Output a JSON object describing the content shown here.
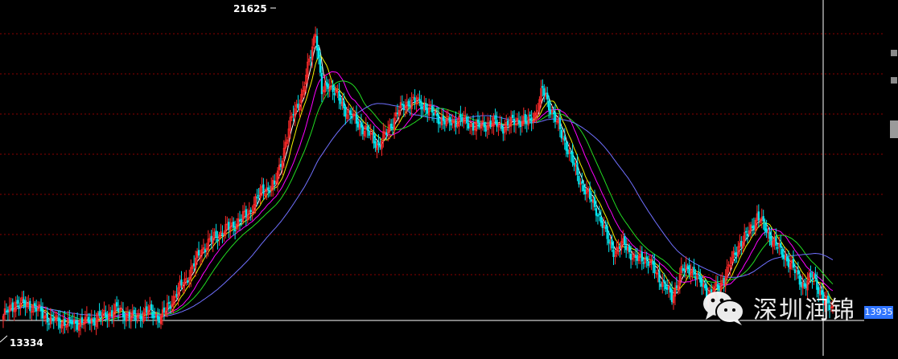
{
  "chart_data": {
    "type": "candlestick",
    "ylim": [
      13000,
      22000
    ],
    "annotations": {
      "high_label": "21625",
      "low_label": "13334",
      "current_price_label": "13935"
    },
    "colors": {
      "up": "#ff2a2a",
      "down": "#00e5ee",
      "grid": "#8b0000",
      "ma_short": "#ffffff",
      "ma_mid": "#f4f400",
      "ma_long": "#ff00ff",
      "ma_longer": "#22dd22",
      "ma_longest": "#7070ff"
    },
    "grid": true,
    "close_path": [
      [
        0,
        13700
      ],
      [
        8,
        14050
      ],
      [
        18,
        13980
      ],
      [
        30,
        13600
      ],
      [
        42,
        13500
      ],
      [
        52,
        13550
      ],
      [
        63,
        13700
      ],
      [
        72,
        13880
      ],
      [
        82,
        13640
      ],
      [
        92,
        13840
      ],
      [
        100,
        13650
      ],
      [
        108,
        14200
      ],
      [
        116,
        14700
      ],
      [
        126,
        15500
      ],
      [
        136,
        15900
      ],
      [
        146,
        16150
      ],
      [
        156,
        16500
      ],
      [
        164,
        17100
      ],
      [
        172,
        17200
      ],
      [
        178,
        18200
      ],
      [
        184,
        19200
      ],
      [
        190,
        19700
      ],
      [
        194,
        20600
      ],
      [
        198,
        21400
      ],
      [
        202,
        19700
      ],
      [
        206,
        20000
      ],
      [
        212,
        19600
      ],
      [
        218,
        19200
      ],
      [
        225,
        18900
      ],
      [
        232,
        18600
      ],
      [
        238,
        18300
      ],
      [
        244,
        18700
      ],
      [
        250,
        19200
      ],
      [
        258,
        19500
      ],
      [
        266,
        19400
      ],
      [
        274,
        19100
      ],
      [
        282,
        18900
      ],
      [
        290,
        19000
      ],
      [
        300,
        18800
      ],
      [
        310,
        18900
      ],
      [
        318,
        18800
      ],
      [
        326,
        19000
      ],
      [
        332,
        18900
      ],
      [
        338,
        19200
      ],
      [
        342,
        19800
      ],
      [
        346,
        19400
      ],
      [
        352,
        18800
      ],
      [
        358,
        18200
      ],
      [
        364,
        17500
      ],
      [
        370,
        17000
      ],
      [
        376,
        16600
      ],
      [
        382,
        15900
      ],
      [
        388,
        15400
      ],
      [
        394,
        15700
      ],
      [
        400,
        15200
      ],
      [
        406,
        15300
      ],
      [
        412,
        15000
      ],
      [
        418,
        14600
      ],
      [
        424,
        14200
      ],
      [
        430,
        14900
      ],
      [
        436,
        15000
      ],
      [
        442,
        14600
      ],
      [
        448,
        14300
      ],
      [
        454,
        14500
      ],
      [
        460,
        15000
      ],
      [
        466,
        15600
      ],
      [
        472,
        15900
      ],
      [
        478,
        16400
      ],
      [
        484,
        16000
      ],
      [
        490,
        15600
      ],
      [
        496,
        15300
      ],
      [
        502,
        14900
      ],
      [
        508,
        14500
      ],
      [
        514,
        14800
      ],
      [
        520,
        14100
      ],
      [
        526,
        13950
      ]
    ],
    "ma_periods": [
      5,
      10,
      20,
      30,
      60
    ]
  }
}
